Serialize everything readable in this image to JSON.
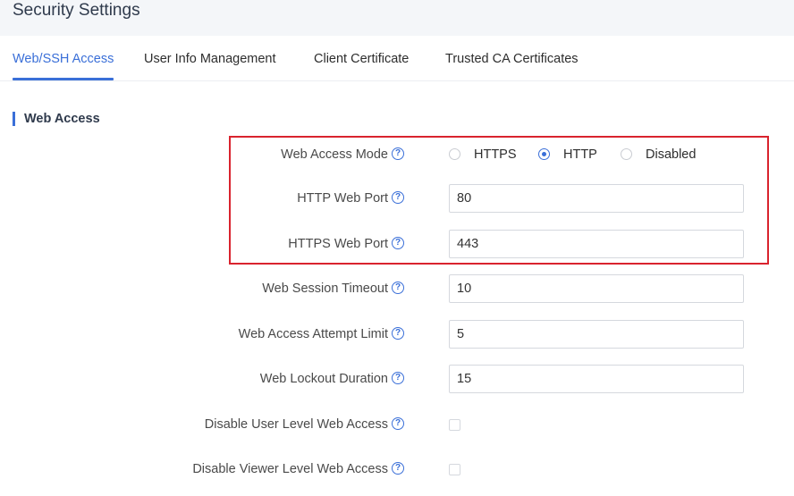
{
  "header": {
    "title": "Security Settings"
  },
  "tabs": [
    {
      "label": "Web/SSH Access",
      "active": true
    },
    {
      "label": "User Info Management",
      "active": false
    },
    {
      "label": "Client Certificate",
      "active": false
    },
    {
      "label": "Trusted CA Certificates",
      "active": false
    }
  ],
  "section": {
    "title": "Web Access"
  },
  "fields": {
    "web_access_mode": {
      "label": "Web Access Mode",
      "options": [
        "HTTPS",
        "HTTP",
        "Disabled"
      ],
      "selected": "HTTP"
    },
    "http_port": {
      "label": "HTTP Web Port",
      "value": "80"
    },
    "https_port": {
      "label": "HTTPS Web Port",
      "value": "443"
    },
    "session_timeout": {
      "label": "Web Session Timeout",
      "value": "10"
    },
    "attempt_limit": {
      "label": "Web Access Attempt Limit",
      "value": "5"
    },
    "lockout_duration": {
      "label": "Web Lockout Duration",
      "value": "15"
    },
    "disable_user_level": {
      "label": "Disable User Level Web Access",
      "checked": false
    },
    "disable_viewer_level": {
      "label": "Disable Viewer Level Web Access",
      "checked": false
    }
  },
  "icons": {
    "help": "question-circle-icon"
  },
  "colors": {
    "accent": "#3a6fd8",
    "highlight_border": "#d9232e"
  }
}
